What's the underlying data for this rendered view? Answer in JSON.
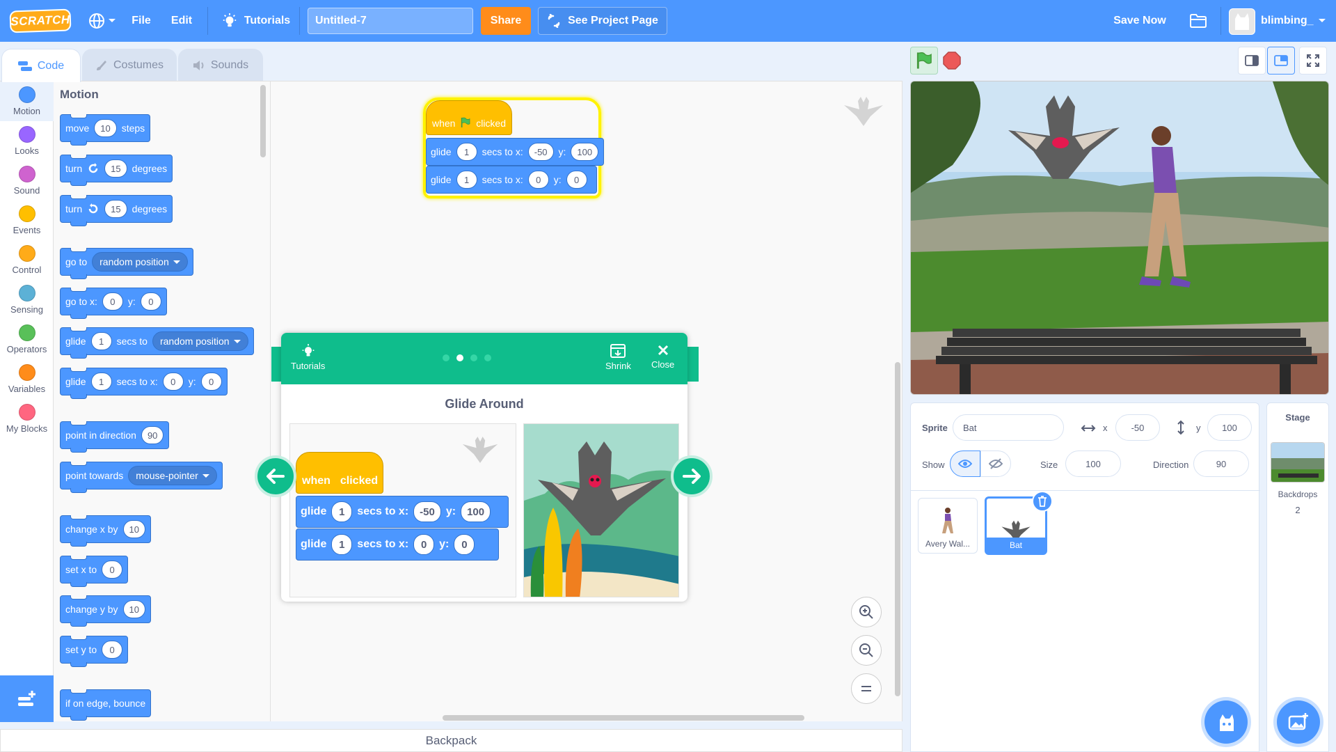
{
  "menubar": {
    "logo": "SCRATCH",
    "file": "File",
    "edit": "Edit",
    "tutorials": "Tutorials",
    "project_title": "Untitled-7",
    "share": "Share",
    "see_project": "See Project Page",
    "save_now": "Save Now",
    "username": "blimbing_"
  },
  "tabs": {
    "code": "Code",
    "costumes": "Costumes",
    "sounds": "Sounds"
  },
  "categories": [
    {
      "label": "Motion",
      "color": "#4c97ff"
    },
    {
      "label": "Looks",
      "color": "#9966ff"
    },
    {
      "label": "Sound",
      "color": "#cf63cf"
    },
    {
      "label": "Events",
      "color": "#ffbf00"
    },
    {
      "label": "Control",
      "color": "#ffab19"
    },
    {
      "label": "Sensing",
      "color": "#5cb1d6"
    },
    {
      "label": "Operators",
      "color": "#59c059"
    },
    {
      "label": "Variables",
      "color": "#ff8c1a"
    },
    {
      "label": "My Blocks",
      "color": "#ff6680"
    }
  ],
  "palette": {
    "heading": "Motion",
    "move": {
      "a": "move",
      "v": "10",
      "b": "steps"
    },
    "turn_right": {
      "a": "turn",
      "v": "15",
      "b": "degrees"
    },
    "turn_left": {
      "a": "turn",
      "v": "15",
      "b": "degrees"
    },
    "goto": {
      "a": "go to",
      "dd": "random position"
    },
    "gotoxy": {
      "a": "go to x:",
      "x": "0",
      "y_lbl": "y:",
      "y": "0"
    },
    "glide_to": {
      "a": "glide",
      "v": "1",
      "b": "secs to",
      "dd": "random position"
    },
    "glide_xy": {
      "a": "glide",
      "v": "1",
      "b": "secs to x:",
      "x": "0",
      "y_lbl": "y:",
      "y": "0"
    },
    "point_dir": {
      "a": "point in direction",
      "v": "90"
    },
    "point_towards": {
      "a": "point towards",
      "dd": "mouse-pointer"
    },
    "change_x": {
      "a": "change x by",
      "v": "10"
    },
    "set_x": {
      "a": "set x to",
      "v": "0"
    },
    "change_y": {
      "a": "change y by",
      "v": "10"
    },
    "set_y": {
      "a": "set y to",
      "v": "0"
    },
    "bounce": "if on edge, bounce"
  },
  "script": {
    "hat": {
      "when": "when",
      "clicked": "clicked"
    },
    "glide1": {
      "a": "glide",
      "secs": "1",
      "b": "secs to x:",
      "x": "-50",
      "y_lbl": "y:",
      "y": "100"
    },
    "glide2": {
      "a": "glide",
      "secs": "1",
      "b": "secs to x:",
      "x": "0",
      "y_lbl": "y:",
      "y": "0"
    }
  },
  "tutorial": {
    "tutorials_label": "Tutorials",
    "shrink": "Shrink",
    "close": "Close",
    "title": "Glide Around",
    "pages": 4,
    "current_page": 2
  },
  "backpack": "Backpack",
  "sprite_info": {
    "sprite_label": "Sprite",
    "sprite_name": "Bat",
    "x_label": "x",
    "x": "-50",
    "y_label": "y",
    "y": "100",
    "show_label": "Show",
    "size_label": "Size",
    "size": "100",
    "direction_label": "Direction",
    "direction": "90"
  },
  "sprites": [
    {
      "name": "Avery Wal...",
      "selected": false
    },
    {
      "name": "Bat",
      "selected": true
    }
  ],
  "stage_pane": {
    "title": "Stage",
    "backdrops_label": "Backdrops",
    "backdrops_count": "2"
  }
}
